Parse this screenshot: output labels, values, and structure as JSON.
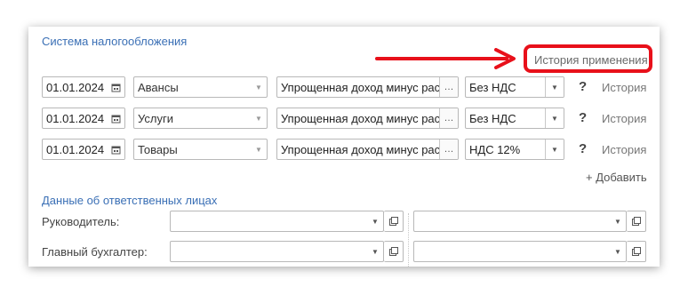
{
  "taxation": {
    "title": "Система налогообложения",
    "history_of_use": "История применения",
    "rows": [
      {
        "date": "01.01.2024",
        "type": "Авансы",
        "system": "Упрощенная доход минус расход",
        "vat": "Без НДС",
        "help": "?",
        "history": "История"
      },
      {
        "date": "01.01.2024",
        "type": "Услуги",
        "system": "Упрощенная доход минус расход",
        "vat": "Без НДС",
        "help": "?",
        "history": "История"
      },
      {
        "date": "01.01.2024",
        "type": "Товары",
        "system": "Упрощенная доход минус расход",
        "vat": "НДС 12%",
        "help": "?",
        "history": "История"
      }
    ],
    "add_label": "+ Добавить"
  },
  "responsible": {
    "title": "Данные об ответственных лицах",
    "rows": [
      {
        "label": "Руководитель:",
        "value1": "",
        "value2": ""
      },
      {
        "label": "Главный бухгалтер:",
        "value1": "",
        "value2": ""
      }
    ]
  },
  "icons": {
    "calendar": "calendar-icon",
    "ellipsis": "…",
    "dropdown": "▾",
    "open": "open-form-icon"
  },
  "colors": {
    "accent": "#3a6fb5",
    "highlight": "#e8101a"
  }
}
